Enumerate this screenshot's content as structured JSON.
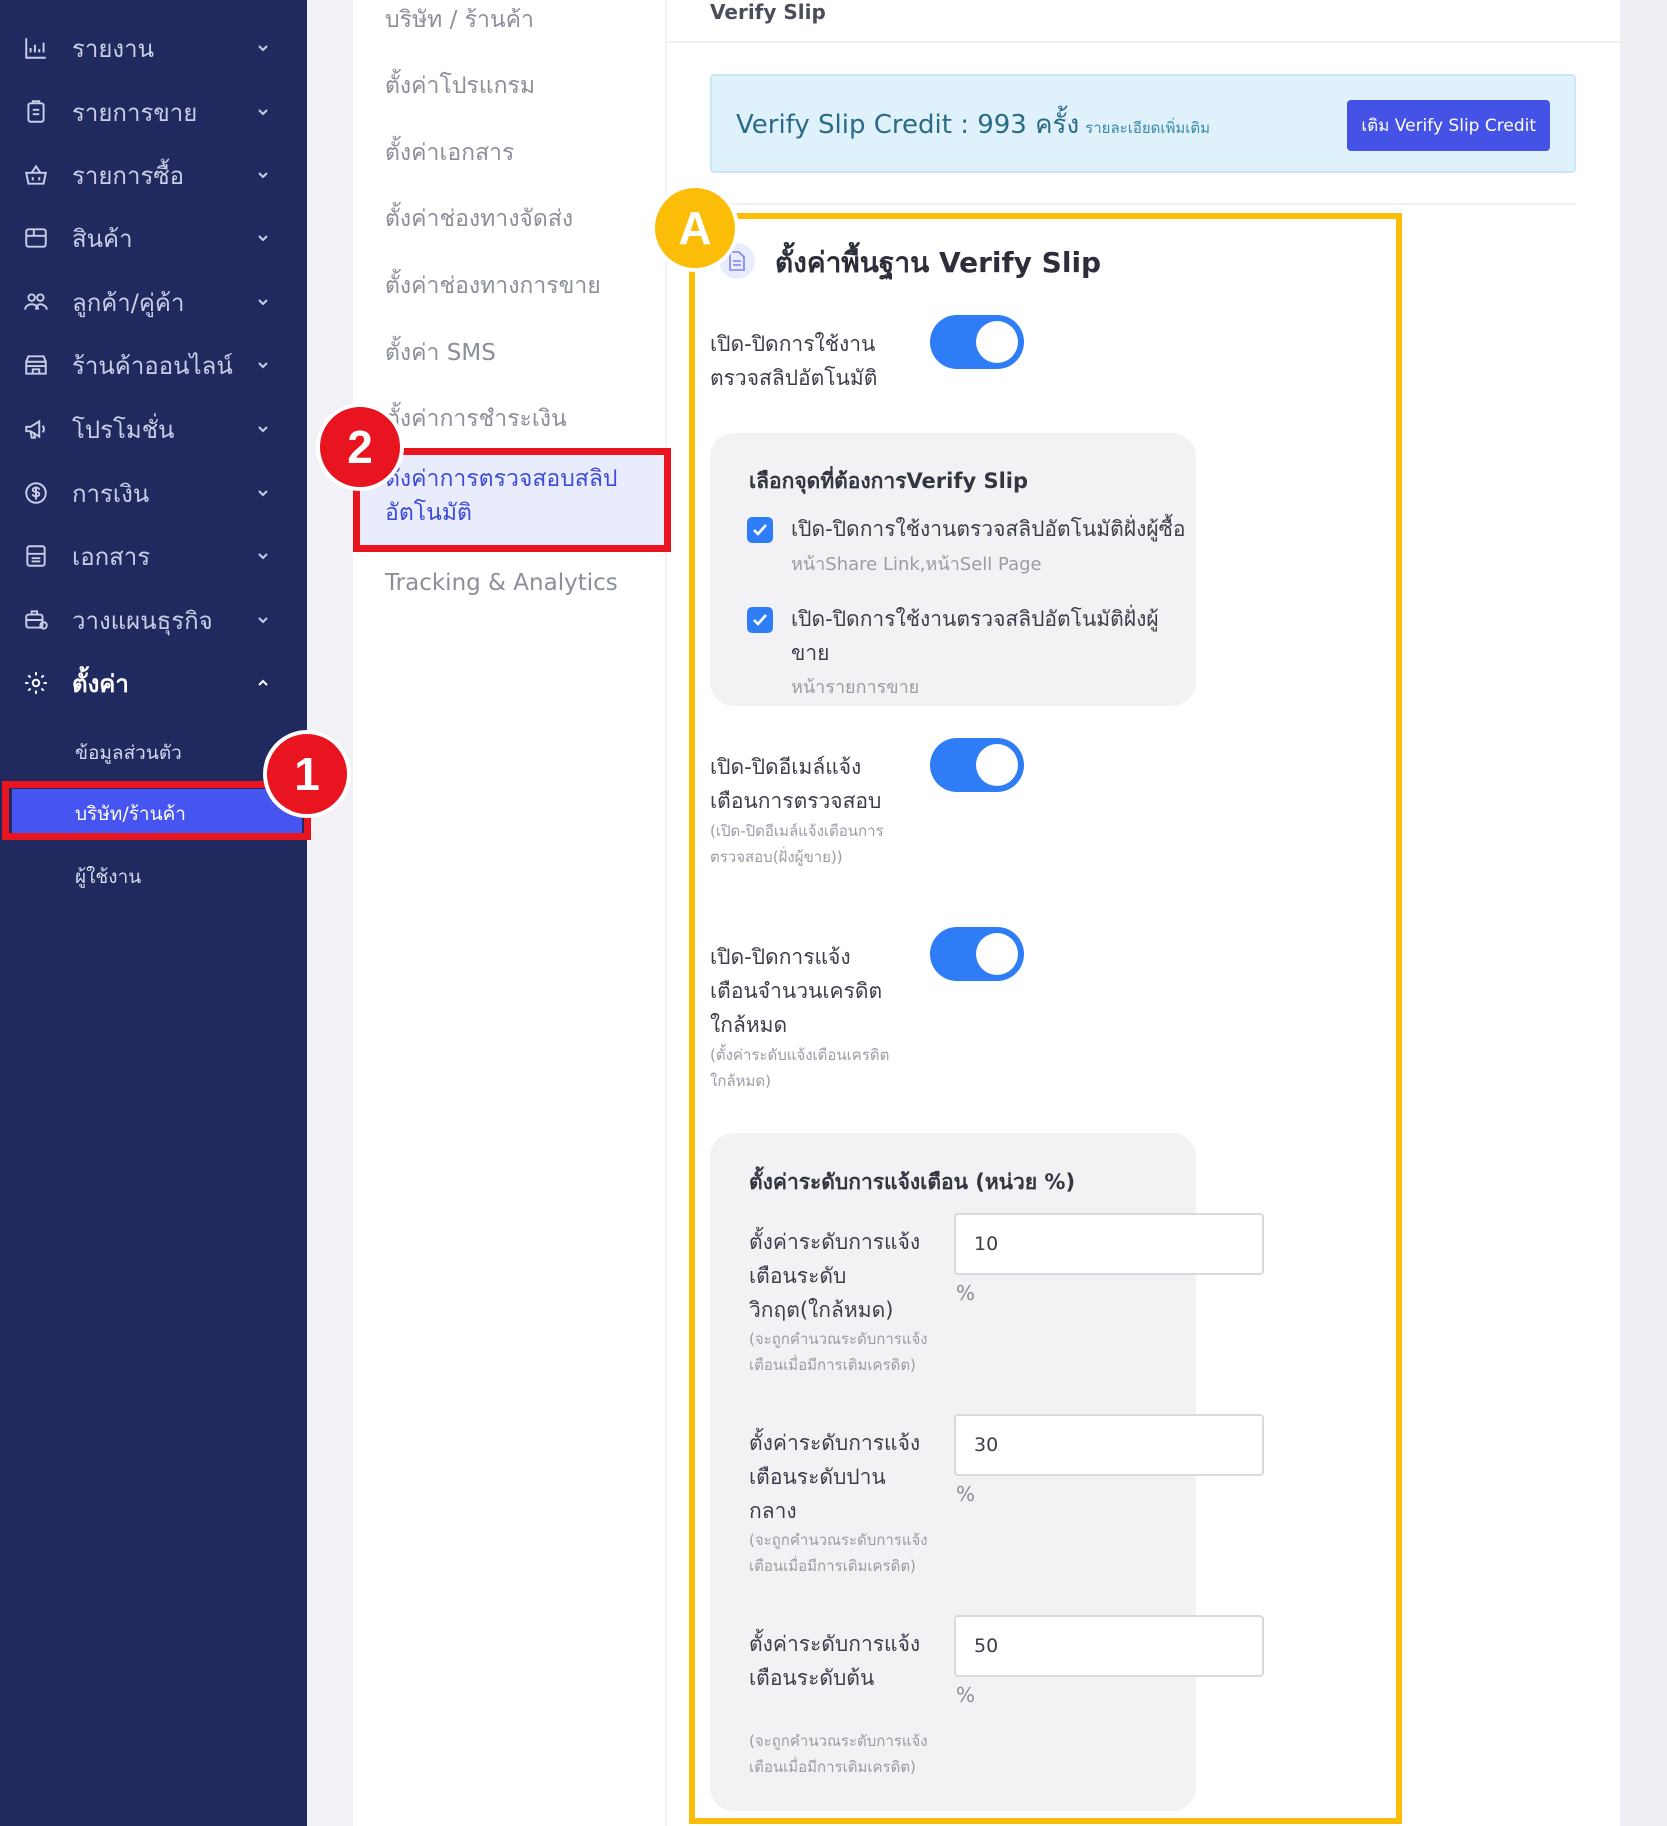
{
  "sidebar": {
    "items": [
      {
        "label": "รายงาน",
        "icon": "bar-chart-icon"
      },
      {
        "label": "รายการขาย",
        "icon": "clipboard-icon"
      },
      {
        "label": "รายการซื้อ",
        "icon": "basket-icon"
      },
      {
        "label": "สินค้า",
        "icon": "box-icon"
      },
      {
        "label": "ลูกค้า/คู่ค้า",
        "icon": "users-icon"
      },
      {
        "label": "ร้านค้าออนไลน์",
        "icon": "store-icon"
      },
      {
        "label": "โปรโมชั่น",
        "icon": "megaphone-icon"
      },
      {
        "label": "การเงิน",
        "icon": "dollar-icon"
      },
      {
        "label": "เอกสาร",
        "icon": "document-icon"
      },
      {
        "label": "วางแผนธุรกิจ",
        "icon": "briefcase-icon"
      },
      {
        "label": "ตั้งค่า",
        "icon": "gear-icon"
      }
    ],
    "settings_sub": [
      "ข้อมูลส่วนตัว",
      "บริษัท/ร้านค้า",
      "ผู้ใช้งาน"
    ]
  },
  "submenu": {
    "items": [
      "บริษัท / ร้านค้า",
      "ตั้งค่าโปรแกรม",
      "ตั้งค่าเอกสาร",
      "ตั้งค่าช่องทางจัดส่ง",
      "ตั้งค่าช่องทางการขาย",
      "ตั้งค่า SMS",
      "ตั้งค่าการชำระเงิน",
      "ตั้งค่าการตรวจสอบสลิปอัตโนมัติ",
      "Tracking & Analytics"
    ]
  },
  "main": {
    "page_title": "Verify Slip",
    "credit_text": "Verify Slip Credit : 993 ครั้ง",
    "credit_detail": "รายละเอียดเพิ่มเติม",
    "credit_button": "เติม Verify Slip Credit",
    "section_title": "ตั้งค่าพื้นฐาน Verify Slip",
    "toggle1_label": "เปิด-ปิดการใช้งานตรวจสลิปอัตโนมัติ",
    "card_title": "เลือกจุดที่ต้องการVerify Slip",
    "cb1_label": "เปิด-ปิดการใช้งานตรวจสลิปอัตโนมัติฝั่งผู้ซื้อ",
    "cb1_sub": "หน้าShare Link,หน้าSell Page",
    "cb2_label": "เปิด-ปิดการใช้งานตรวจสลิปอัตโนมัติฝั่งผู้ขาย",
    "cb2_sub": "หน้ารายการขาย",
    "toggle2_label": "เปิด-ปิดอีเมล์แจ้งเตือนการตรวจสอบ",
    "toggle2_hint": "(เปิด-ปิดอีเมล์แจ้งเตือนการตรวจสอบ(ฝั่งผู้ขาย))",
    "toggle3_label": "เปิด-ปิดการแจ้งเตือนจำนวนเครดิตใกล้หมด",
    "toggle3_hint": "(ตั้งค่าระดับแจ้งเตือนเครดิตใกล้หมด)",
    "levels_title": "ตั้งค่าระดับการแจ้งเตือน (หน่วย %)",
    "levels": [
      {
        "label": "ตั้งค่าระดับการแจ้งเตือนระดับวิกฤต(ใกล้หมด)",
        "hint": "(จะถูกคำนวณระดับการแจ้งเตือนเมื่อมีการเติมเครดิต)",
        "value": "10",
        "unit": "%"
      },
      {
        "label": "ตั้งค่าระดับการแจ้งเตือนระดับปานกลาง",
        "hint": "(จะถูกคำนวณระดับการแจ้งเตือนเมื่อมีการเติมเครดิต)",
        "value": "30",
        "unit": "%"
      },
      {
        "label": "ตั้งค่าระดับการแจ้งเตือนระดับต้น",
        "hint": "(จะถูกคำนวณระดับการแจ้งเตือนเมื่อมีการเติมเครดิต)",
        "value": "50",
        "unit": "%"
      }
    ]
  },
  "annotations": {
    "badge1": "1",
    "badge2": "2",
    "badgeA": "A"
  },
  "colors": {
    "sidebar": "#202a5e",
    "accent": "#4654f0",
    "toggle": "#2f7df6",
    "highlight_red": "#e8141f",
    "highlight_yellow": "#fbbd08"
  }
}
